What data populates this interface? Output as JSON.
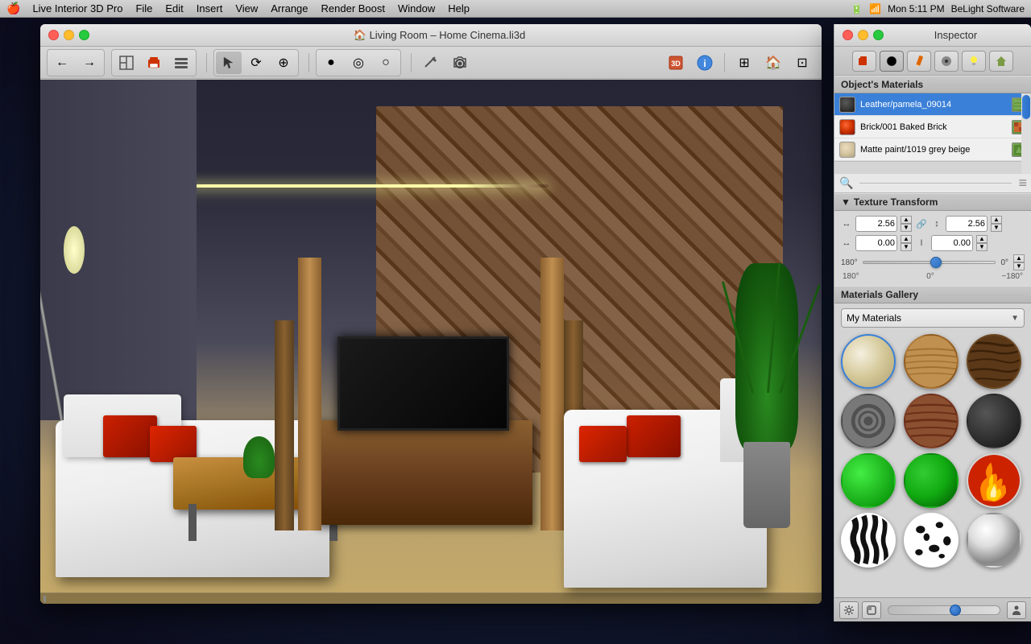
{
  "menubar": {
    "apple": "🍎",
    "items": [
      "Live Interior 3D Pro",
      "File",
      "Edit",
      "Insert",
      "View",
      "Arrange",
      "Render Boost",
      "Window",
      "Help"
    ],
    "right": [
      "🔋",
      "4",
      "Mon 5:11 PM",
      "BeLight Software"
    ]
  },
  "window": {
    "title": "🏠 Living Room – Home Cinema.li3d",
    "traffic_lights": [
      "close",
      "minimize",
      "maximize"
    ]
  },
  "toolbar": {
    "nav_back": "←",
    "nav_fwd": "→",
    "tools": [
      "🏠",
      "📋",
      "☰"
    ],
    "modes": [
      "↖",
      "⟳",
      "⊕"
    ],
    "shapes": [
      "●",
      "◎",
      "○"
    ],
    "misc": [
      "⚡",
      "📷"
    ],
    "right_tools": [
      "🎲",
      "ℹ",
      "⊞",
      "🏠",
      "⊡"
    ]
  },
  "inspector": {
    "title": "Inspector",
    "tabs": [
      "🏷",
      "⭕",
      "✏",
      "💿",
      "💡",
      "🏠"
    ],
    "objects_materials_label": "Object's Materials",
    "materials": [
      {
        "name": "Leather/pamela_09014",
        "color": "#3a3a3a",
        "selected": true
      },
      {
        "name": "Brick/001 Baked Brick",
        "color": "#cc3300",
        "selected": false
      },
      {
        "name": "Matte paint/1019 grey beige",
        "color": "#d4c4a8",
        "selected": false
      }
    ],
    "texture_transform": {
      "label": "Texture Transform",
      "width_val": "2.56",
      "height_val": "2.56",
      "offset_x": "0.00",
      "offset_y": "0.00",
      "rotation_val": "0°",
      "slider_left": "180°",
      "slider_center": "0°",
      "slider_right": "−180°"
    },
    "gallery": {
      "label": "Materials Gallery",
      "dropdown_value": "My Materials",
      "swatches": [
        {
          "type": "cream",
          "name": "Cream Fabric"
        },
        {
          "type": "wood-light",
          "name": "Light Wood"
        },
        {
          "type": "wood-dark2",
          "name": "Dark Wood Brick"
        },
        {
          "type": "metal-dark",
          "name": "Stone Metal"
        },
        {
          "type": "wood-red",
          "name": "Red Wood"
        },
        {
          "type": "dark-sphere",
          "name": "Dark Material"
        },
        {
          "type": "green1",
          "name": "Green 1"
        },
        {
          "type": "green2",
          "name": "Green 2"
        },
        {
          "type": "fire",
          "name": "Fire"
        },
        {
          "type": "zebra",
          "name": "Zebra"
        },
        {
          "type": "dalmatian",
          "name": "Dalmatian"
        },
        {
          "type": "silver",
          "name": "Silver"
        }
      ]
    }
  }
}
